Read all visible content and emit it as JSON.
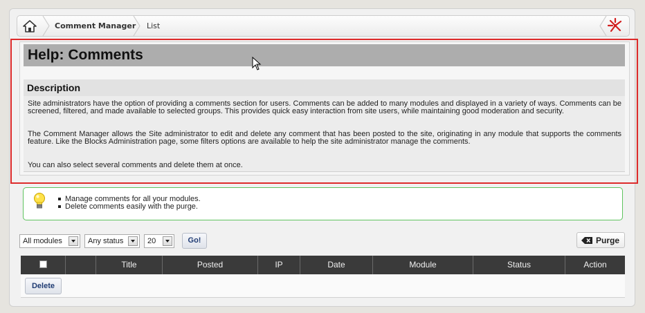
{
  "breadcrumb": {
    "home_icon": "home-icon",
    "items": [
      "Comment Manager",
      "List"
    ],
    "right_icon": "joomla-logo-icon"
  },
  "help": {
    "title": "Help: Comments",
    "section_title": "Description",
    "paragraphs": [
      "Site administrators have the option of providing a comments section for users. Comments can be added to many modules and displayed in a variety of ways. Comments can be screened, filtered, and made available to selected groups. This provides quick easy interaction from site users, while maintaining good moderation and security.",
      "The Comment Manager allows the Site administrator to edit and delete any comment that has been posted to the site, originating in any module that supports the comments feature. Like the Blocks Administration page, some filters options are available to help the site administrator manage the comments.",
      "You can also select several comments and delete them at once."
    ]
  },
  "tips": {
    "icon": "lightbulb-icon",
    "items": [
      "Manage comments for all your modules.",
      "Delete comments easily with the purge."
    ]
  },
  "filters": {
    "module": "All modules",
    "status": "Any status",
    "limit": "20",
    "go_label": "Go!",
    "purge_label": "Purge",
    "purge_icon": "erase-icon"
  },
  "table": {
    "columns": [
      "",
      "",
      "Title",
      "Posted",
      "IP",
      "Date",
      "Module",
      "Status",
      "Action"
    ],
    "delete_label": "Delete"
  },
  "colors": {
    "highlight_border": "#dd2a2a",
    "tips_border": "#5ec35e",
    "table_header": "#3a3a3a",
    "title_bar": "#adadad"
  }
}
